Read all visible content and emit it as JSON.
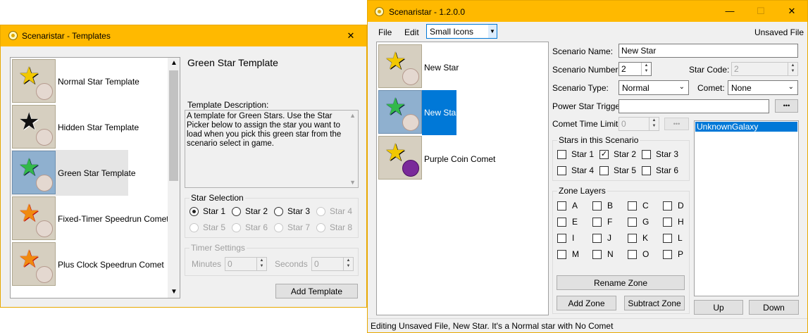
{
  "colors": {
    "titlebar": "#ffb900",
    "selection": "#0078d7",
    "star_yellow": "#f2c800"
  },
  "templates_window": {
    "title": "Scenaristar - Templates",
    "close_glyph": "✕",
    "list": [
      {
        "label": "Normal Star Template",
        "icon": "yellow-star-icon"
      },
      {
        "label": "Hidden Star Template",
        "icon": "question-star-icon"
      },
      {
        "label": "Green Star Template",
        "icon": "green-star-icon",
        "selected": true
      },
      {
        "label": "Fixed-Timer Speedrun Comet",
        "icon": "red-star-icon"
      },
      {
        "label": "Plus Clock Speedrun Comet",
        "icon": "red-star-icon"
      }
    ],
    "heading": "Green Star Template",
    "description_label": "Template Description:",
    "description": "A template for Green Stars. Use the Star Picker below to assign the star you want to load when you pick this green star from the scenario select in game.",
    "star_selection_title": "Star Selection",
    "stars": [
      "Star 1",
      "Star 2",
      "Star 3",
      "Star 4",
      "Star 5",
      "Star 6",
      "Star 7",
      "Star 8"
    ],
    "selected_star": "Star 1",
    "timer_title": "Timer Settings",
    "minutes_label": "Minutes",
    "minutes_value": "0",
    "seconds_label": "Seconds",
    "seconds_value": "0",
    "add_button": "Add Template"
  },
  "main_window": {
    "title": "Scenaristar - 1.2.0.0",
    "min_glyph": "—",
    "max_glyph": "☐",
    "close_glyph": "✕",
    "menu": {
      "file": "File",
      "edit": "Edit",
      "view_select": "Small Icons",
      "status_right": "Unsaved File"
    },
    "stars_list": [
      {
        "label": "New Star",
        "icon": "yellow-star-icon"
      },
      {
        "label": "New Star",
        "icon": "green-star-icon",
        "selected": true
      },
      {
        "label": "Purple Coin Comet",
        "icon": "purple-coin-star-icon"
      }
    ],
    "form": {
      "scenario_name_label": "Scenario Name:",
      "scenario_name": "New Star",
      "scenario_number_label": "Scenario Number:",
      "scenario_number": "2",
      "star_code_label": "Star Code:",
      "star_code": "2",
      "scenario_type_label": "Scenario Type:",
      "scenario_type": "Normal",
      "comet_label": "Comet:",
      "comet": "None",
      "power_star_trigger_label": "Power Star Trigger:",
      "power_star_trigger": "",
      "ellipsis": "•••",
      "comet_time_limit_label": "Comet Time Limit:",
      "comet_time_limit": "0",
      "stars_group_title": "Stars in this Scenario",
      "stars": [
        "Star 1",
        "Star 2",
        "Star 3",
        "Star 4",
        "Star 5",
        "Star 6"
      ],
      "stars_checked": [
        "Star 2"
      ],
      "zone_layers_title": "Zone Layers",
      "zone_layers": [
        "A",
        "B",
        "C",
        "D",
        "E",
        "F",
        "G",
        "H",
        "I",
        "J",
        "K",
        "L",
        "M",
        "N",
        "O",
        "P"
      ],
      "rename_zone": "Rename Zone",
      "add_zone": "Add Zone",
      "subtract_zone": "Subtract Zone",
      "galaxies": [
        "UnknownGalaxy"
      ],
      "up": "Up",
      "down": "Down"
    },
    "status_text": "Editing Unsaved File, New Star. It's a Normal star with No Comet"
  }
}
